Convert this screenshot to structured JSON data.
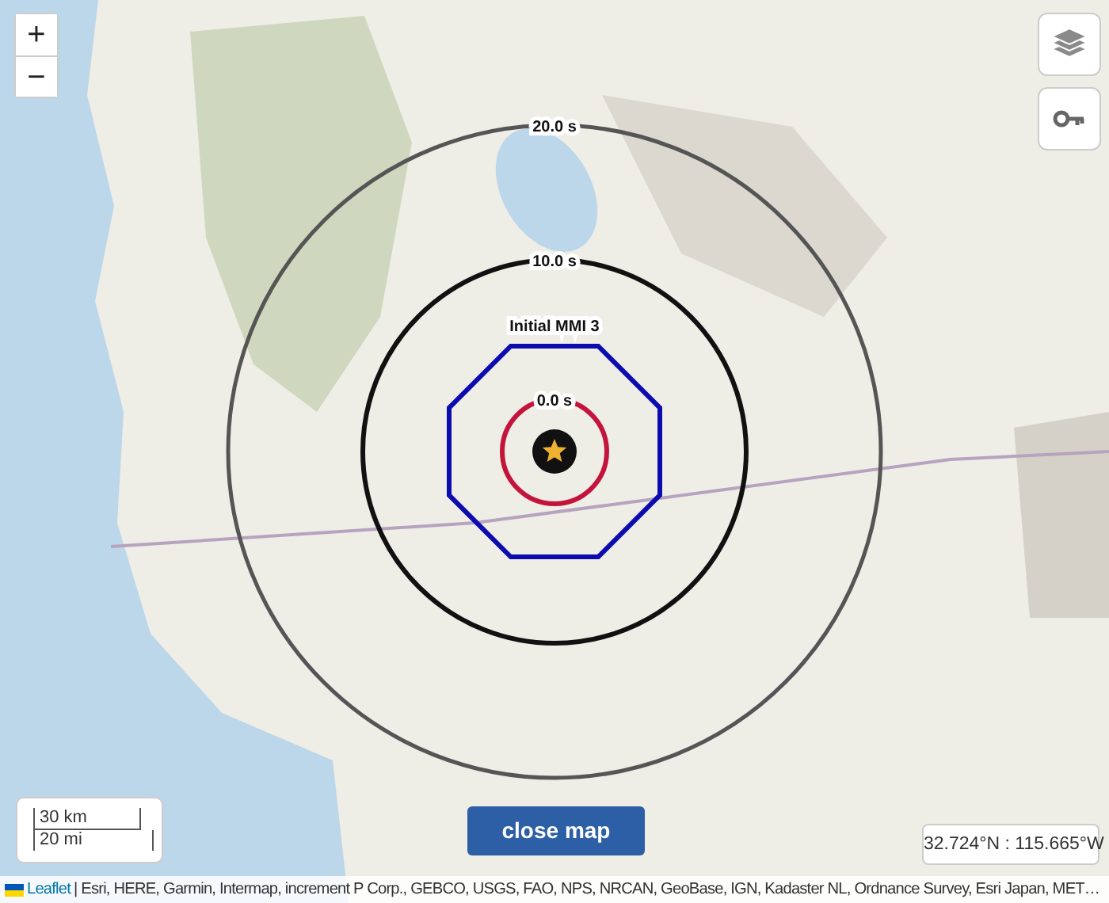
{
  "zoom_controls": [
    "+",
    "−"
  ],
  "map_controls": [
    {
      "kind": "layers"
    },
    {
      "kind": "key"
    }
  ],
  "rings": [
    {
      "kind": "circle",
      "label": "20.0 s",
      "color": "#555555"
    },
    {
      "kind": "circle",
      "label": "10.0 s",
      "color": "#111111"
    },
    {
      "kind": "circle",
      "label": "0.0 s",
      "color": "#c4143c"
    }
  ],
  "intensity_contour": {
    "kind": "octagon",
    "label": "Initial MMI 3"
  },
  "scale": {
    "metric": "30 km",
    "imperial": "20 mi"
  },
  "close_button": "close map",
  "coordinates": "32.724°N : 115.665°W",
  "attribution": {
    "link": "Leaflet",
    "text": "| Esri, HERE, Garmin, Intermap, increment P Corp., GEBCO, USGS, FAO, NPS, NRCAN, GeoBase, IGN, Kadaster NL, Ordnance Survey, Esri Japan, MET…"
  }
}
